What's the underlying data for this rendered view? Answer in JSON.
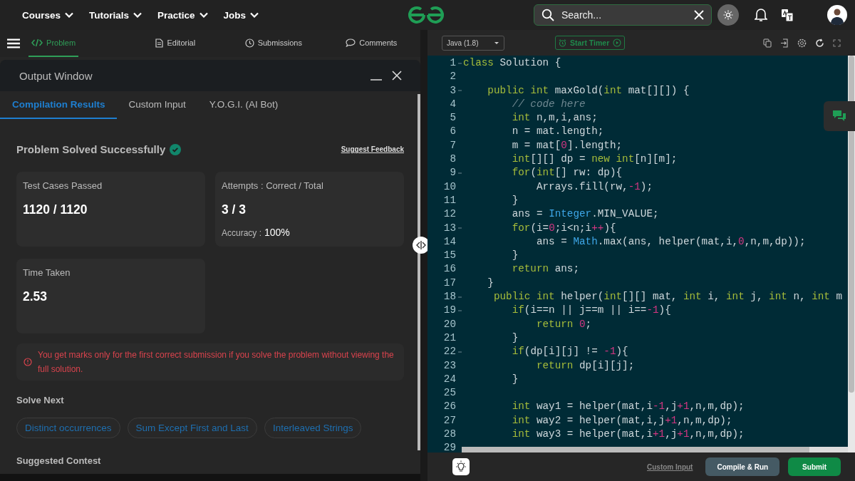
{
  "nav": {
    "menus": [
      "Courses",
      "Tutorials",
      "Practice",
      "Jobs"
    ],
    "search": {
      "placeholder": "Search..."
    }
  },
  "problem_tabs": [
    {
      "label": "Problem",
      "selected": true
    },
    {
      "label": "Editorial",
      "selected": false
    },
    {
      "label": "Submissions",
      "selected": false
    },
    {
      "label": "Comments",
      "selected": false
    }
  ],
  "output_window": {
    "title": "Output Window",
    "tabs": [
      {
        "label": "Compilation Results",
        "selected": true
      },
      {
        "label": "Custom Input",
        "selected": false
      },
      {
        "label": "Y.O.G.I. (AI Bot)",
        "selected": false
      }
    ],
    "status": "Problem Solved Successfully",
    "feedback_link": "Suggest Feedback",
    "stats": [
      {
        "label": "Test Cases Passed",
        "value": "1120 / 1120"
      },
      {
        "label": "Attempts : Correct / Total",
        "value": "3 / 3",
        "extra_label": "Accuracy :",
        "extra_value": "100%"
      },
      {
        "label": "Time Taken",
        "value": "2.53"
      }
    ],
    "warning": "You get marks only for the first correct submission if you solve the problem without viewing the full solution.",
    "solve_next": {
      "title": "Solve Next",
      "items": [
        "Distinct occurrences",
        "Sum Except First and Last",
        "Interleaved Strings"
      ]
    },
    "suggested_contest_title": "Suggested Contest"
  },
  "editor": {
    "language": "Java (1.8)",
    "timer_button": "Start Timer",
    "lines": [
      {
        "n": "1",
        "fold": true,
        "tokens": [
          {
            "t": "class",
            "kind": "kw"
          },
          {
            "t": " Solution {",
            "kind": "txt"
          }
        ]
      },
      {
        "n": "2",
        "fold": false
      },
      {
        "n": "3",
        "fold": true,
        "tokens": [
          {
            "t": "    public",
            "kind": "kw"
          },
          {
            "t": " int",
            "kind": "kw"
          },
          {
            "t": " maxGold(",
            "kind": "txt"
          },
          {
            "t": "int",
            "kind": "kw"
          },
          {
            "t": " mat[][]) {",
            "kind": "txt"
          }
        ]
      },
      {
        "n": "4",
        "fold": false,
        "tokens": [
          {
            "t": "        // code here",
            "kind": "cmt"
          }
        ]
      },
      {
        "n": "5",
        "fold": false,
        "tokens": [
          {
            "t": "        int",
            "kind": "kw"
          },
          {
            "t": " n,m,i,ans;",
            "kind": "txt"
          }
        ]
      },
      {
        "n": "6",
        "fold": false,
        "tokens": [
          {
            "t": "        n = mat.length;",
            "kind": "txt"
          }
        ]
      },
      {
        "n": "7",
        "fold": false,
        "tokens": [
          {
            "t": "        m = mat[",
            "kind": "txt"
          },
          {
            "t": "0",
            "kind": "num"
          },
          {
            "t": "].length;",
            "kind": "txt"
          }
        ]
      },
      {
        "n": "8",
        "fold": false,
        "tokens": [
          {
            "t": "        int",
            "kind": "kw"
          },
          {
            "t": "[][] dp = ",
            "kind": "txt"
          },
          {
            "t": "new",
            "kind": "kw"
          },
          {
            "t": " int",
            "kind": "kw"
          },
          {
            "t": "[n][m];",
            "kind": "txt"
          }
        ]
      },
      {
        "n": "9",
        "fold": true,
        "tokens": [
          {
            "t": "        for",
            "kind": "kw"
          },
          {
            "t": "(",
            "kind": "txt"
          },
          {
            "t": "int",
            "kind": "kw"
          },
          {
            "t": "[] rw: dp){",
            "kind": "txt"
          }
        ]
      },
      {
        "n": "10",
        "fold": false,
        "tokens": [
          {
            "t": "            Arrays.fill(rw,",
            "kind": "txt"
          },
          {
            "t": "-1",
            "kind": "num"
          },
          {
            "t": ");",
            "kind": "txt"
          }
        ]
      },
      {
        "n": "11",
        "fold": false,
        "tokens": [
          {
            "t": "        }",
            "kind": "txt"
          }
        ]
      },
      {
        "n": "12",
        "fold": false,
        "tokens": [
          {
            "t": "        ans = ",
            "kind": "txt"
          },
          {
            "t": "Integer",
            "kind": "type"
          },
          {
            "t": ".MIN_VALUE;",
            "kind": "txt"
          }
        ]
      },
      {
        "n": "13",
        "fold": true,
        "tokens": [
          {
            "t": "        for",
            "kind": "kw"
          },
          {
            "t": "(i=",
            "kind": "txt"
          },
          {
            "t": "0",
            "kind": "num"
          },
          {
            "t": ";i<n;i",
            "kind": "txt"
          },
          {
            "t": "++",
            "kind": "num"
          },
          {
            "t": "){",
            "kind": "txt"
          }
        ]
      },
      {
        "n": "14",
        "fold": false,
        "tokens": [
          {
            "t": "            ans = ",
            "kind": "txt"
          },
          {
            "t": "Math",
            "kind": "type"
          },
          {
            "t": ".max(ans, helper(mat,i,",
            "kind": "txt"
          },
          {
            "t": "0",
            "kind": "num"
          },
          {
            "t": ",n,m,dp));",
            "kind": "txt"
          }
        ]
      },
      {
        "n": "15",
        "fold": false,
        "tokens": [
          {
            "t": "        }",
            "kind": "txt"
          }
        ]
      },
      {
        "n": "16",
        "fold": false,
        "tokens": [
          {
            "t": "        return",
            "kind": "kw"
          },
          {
            "t": " ans;",
            "kind": "txt"
          }
        ]
      },
      {
        "n": "17",
        "fold": false,
        "tokens": [
          {
            "t": "    }",
            "kind": "txt"
          }
        ]
      },
      {
        "n": "18",
        "fold": true,
        "tokens": [
          {
            "t": "     public",
            "kind": "kw"
          },
          {
            "t": " int",
            "kind": "kw"
          },
          {
            "t": " helper(",
            "kind": "txt"
          },
          {
            "t": "int",
            "kind": "kw"
          },
          {
            "t": "[][] mat, ",
            "kind": "txt"
          },
          {
            "t": "int",
            "kind": "kw"
          },
          {
            "t": " i, ",
            "kind": "txt"
          },
          {
            "t": "int",
            "kind": "kw"
          },
          {
            "t": " j, ",
            "kind": "txt"
          },
          {
            "t": "int",
            "kind": "kw"
          },
          {
            "t": " n, ",
            "kind": "txt"
          },
          {
            "t": "int",
            "kind": "kw"
          },
          {
            "t": " m",
            "kind": "txt"
          }
        ]
      },
      {
        "n": "19",
        "fold": true,
        "tokens": [
          {
            "t": "        if",
            "kind": "kw"
          },
          {
            "t": "(i==n || j==m || i==",
            "kind": "txt"
          },
          {
            "t": "-1",
            "kind": "num"
          },
          {
            "t": "){",
            "kind": "txt"
          }
        ]
      },
      {
        "n": "20",
        "fold": false,
        "tokens": [
          {
            "t": "            return",
            "kind": "kw"
          },
          {
            "t": " 0",
            "kind": "num"
          },
          {
            "t": ";",
            "kind": "txt"
          }
        ]
      },
      {
        "n": "21",
        "fold": false,
        "tokens": [
          {
            "t": "        }",
            "kind": "txt"
          }
        ]
      },
      {
        "n": "22",
        "fold": true,
        "tokens": [
          {
            "t": "        if",
            "kind": "kw"
          },
          {
            "t": "(dp[i][j] != ",
            "kind": "txt"
          },
          {
            "t": "-1",
            "kind": "num"
          },
          {
            "t": "){",
            "kind": "txt"
          }
        ]
      },
      {
        "n": "23",
        "fold": false,
        "tokens": [
          {
            "t": "            return",
            "kind": "kw"
          },
          {
            "t": " dp[i][j];",
            "kind": "txt"
          }
        ]
      },
      {
        "n": "24",
        "fold": false,
        "tokens": [
          {
            "t": "        }",
            "kind": "txt"
          }
        ]
      },
      {
        "n": "25",
        "fold": false
      },
      {
        "n": "26",
        "fold": false,
        "tokens": [
          {
            "t": "        int",
            "kind": "kw"
          },
          {
            "t": " way1 = helper(mat,i",
            "kind": "txt"
          },
          {
            "t": "-1",
            "kind": "num"
          },
          {
            "t": ",j",
            "kind": "txt"
          },
          {
            "t": "+1",
            "kind": "num"
          },
          {
            "t": ",n,m,dp);",
            "kind": "txt"
          }
        ]
      },
      {
        "n": "27",
        "fold": false,
        "tokens": [
          {
            "t": "        int",
            "kind": "kw"
          },
          {
            "t": " way2 = helper(mat,i,j",
            "kind": "txt"
          },
          {
            "t": "+1",
            "kind": "num"
          },
          {
            "t": ",n,m,dp);",
            "kind": "txt"
          }
        ]
      },
      {
        "n": "28",
        "fold": false,
        "tokens": [
          {
            "t": "        int",
            "kind": "kw"
          },
          {
            "t": " way3 = helper(mat,i",
            "kind": "txt"
          },
          {
            "t": "+1",
            "kind": "num"
          },
          {
            "t": ",j",
            "kind": "txt"
          },
          {
            "t": "+1",
            "kind": "num"
          },
          {
            "t": ",n,m,dp);",
            "kind": "txt"
          }
        ]
      },
      {
        "n": "29",
        "fold": false
      }
    ]
  },
  "footer": {
    "custom_input": "Custom Input",
    "compile": "Compile & Run",
    "submit": "Submit"
  }
}
